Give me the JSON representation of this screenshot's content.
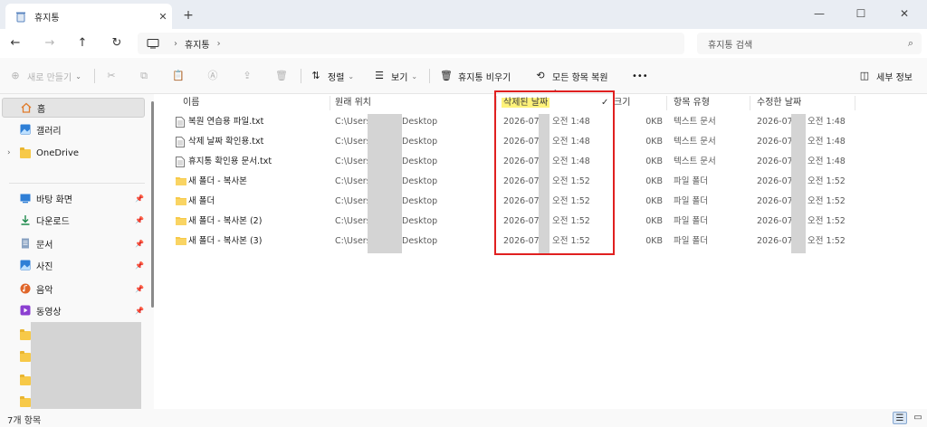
{
  "tab": {
    "title": "휴지통",
    "close": "✕",
    "new": "+"
  },
  "window": {
    "minimize": "—",
    "maximize": "☐",
    "close": "✕"
  },
  "nav": {
    "back": "←",
    "forward": "→",
    "up": "↑",
    "refresh": "↻",
    "breadcrumb": [
      "휴지통"
    ],
    "search_placeholder": "휴지통 검색"
  },
  "toolbar": {
    "new": "새로 만들기",
    "sort": "정렬",
    "view": "보기",
    "empty_bin": "휴지통 비우기",
    "restore_all": "모든 항목 복원",
    "more": "•••",
    "details": "세부 정보"
  },
  "sidebar": {
    "home": "홈",
    "gallery": "갤러리",
    "onedrive": "OneDrive",
    "quick": [
      {
        "label": "바탕 화면"
      },
      {
        "label": "다운로드"
      },
      {
        "label": "문서"
      },
      {
        "label": "사진"
      },
      {
        "label": "음악"
      },
      {
        "label": "동영상"
      }
    ]
  },
  "columns": {
    "name": "이름",
    "location": "원래 위치",
    "deleted": "삭제된 날짜",
    "size": "크기",
    "type": "항목 유형",
    "modified": "수정한 날짜"
  },
  "rows": [
    {
      "name": "복원 연습용 파일.txt",
      "kind": "file",
      "loc_a": "C:\\Users",
      "loc_b": "Desktop",
      "del_date": "2026-07-",
      "del_time": "오전 1:48",
      "size": "0KB",
      "type": "텍스트 문서",
      "mod_date": "2026-07-",
      "mod_time": "오전 1:48"
    },
    {
      "name": "삭제 날짜 확인용.txt",
      "kind": "file",
      "loc_a": "C:\\Users",
      "loc_b": "Desktop",
      "del_date": "2026-07-",
      "del_time": "오전 1:48",
      "size": "0KB",
      "type": "텍스트 문서",
      "mod_date": "2026-07-",
      "mod_time": "오전 1:48"
    },
    {
      "name": "휴지통 확인용 문서.txt",
      "kind": "file",
      "loc_a": "C:\\Users",
      "loc_b": "Desktop",
      "del_date": "2026-07-",
      "del_time": "오전 1:48",
      "size": "0KB",
      "type": "텍스트 문서",
      "mod_date": "2026-07-",
      "mod_time": "오전 1:48"
    },
    {
      "name": "새 폴더 - 복사본",
      "kind": "folder",
      "loc_a": "C:\\Users",
      "loc_b": "Desktop",
      "del_date": "2026-07-",
      "del_time": "오전 1:52",
      "size": "0KB",
      "type": "파일 폴더",
      "mod_date": "2026-07-",
      "mod_time": "오전 1:52"
    },
    {
      "name": "새 폴더",
      "kind": "folder",
      "loc_a": "C:\\Users",
      "loc_b": "Desktop",
      "del_date": "2026-07-",
      "del_time": "오전 1:52",
      "size": "0KB",
      "type": "파일 폴더",
      "mod_date": "2026-07-",
      "mod_time": "오전 1:52"
    },
    {
      "name": "새 폴더 - 복사본 (2)",
      "kind": "folder",
      "loc_a": "C:\\Users",
      "loc_b": "Desktop",
      "del_date": "2026-07-",
      "del_time": "오전 1:52",
      "size": "0KB",
      "type": "파일 폴더",
      "mod_date": "2026-07-",
      "mod_time": "오전 1:52"
    },
    {
      "name": "새 폴더 - 복사본 (3)",
      "kind": "folder",
      "loc_a": "C:\\Users",
      "loc_b": "Desktop",
      "del_date": "2026-07-",
      "del_time": "오전 1:52",
      "size": "0KB",
      "type": "파일 폴더",
      "mod_date": "2026-07-",
      "mod_time": "오전 1:52"
    }
  ],
  "status": {
    "count": "7개 항목"
  },
  "colors": {
    "highlight": "#fff37a",
    "annotation": "#e02020",
    "folder": "#f7c948",
    "accent": "#0067c0"
  }
}
